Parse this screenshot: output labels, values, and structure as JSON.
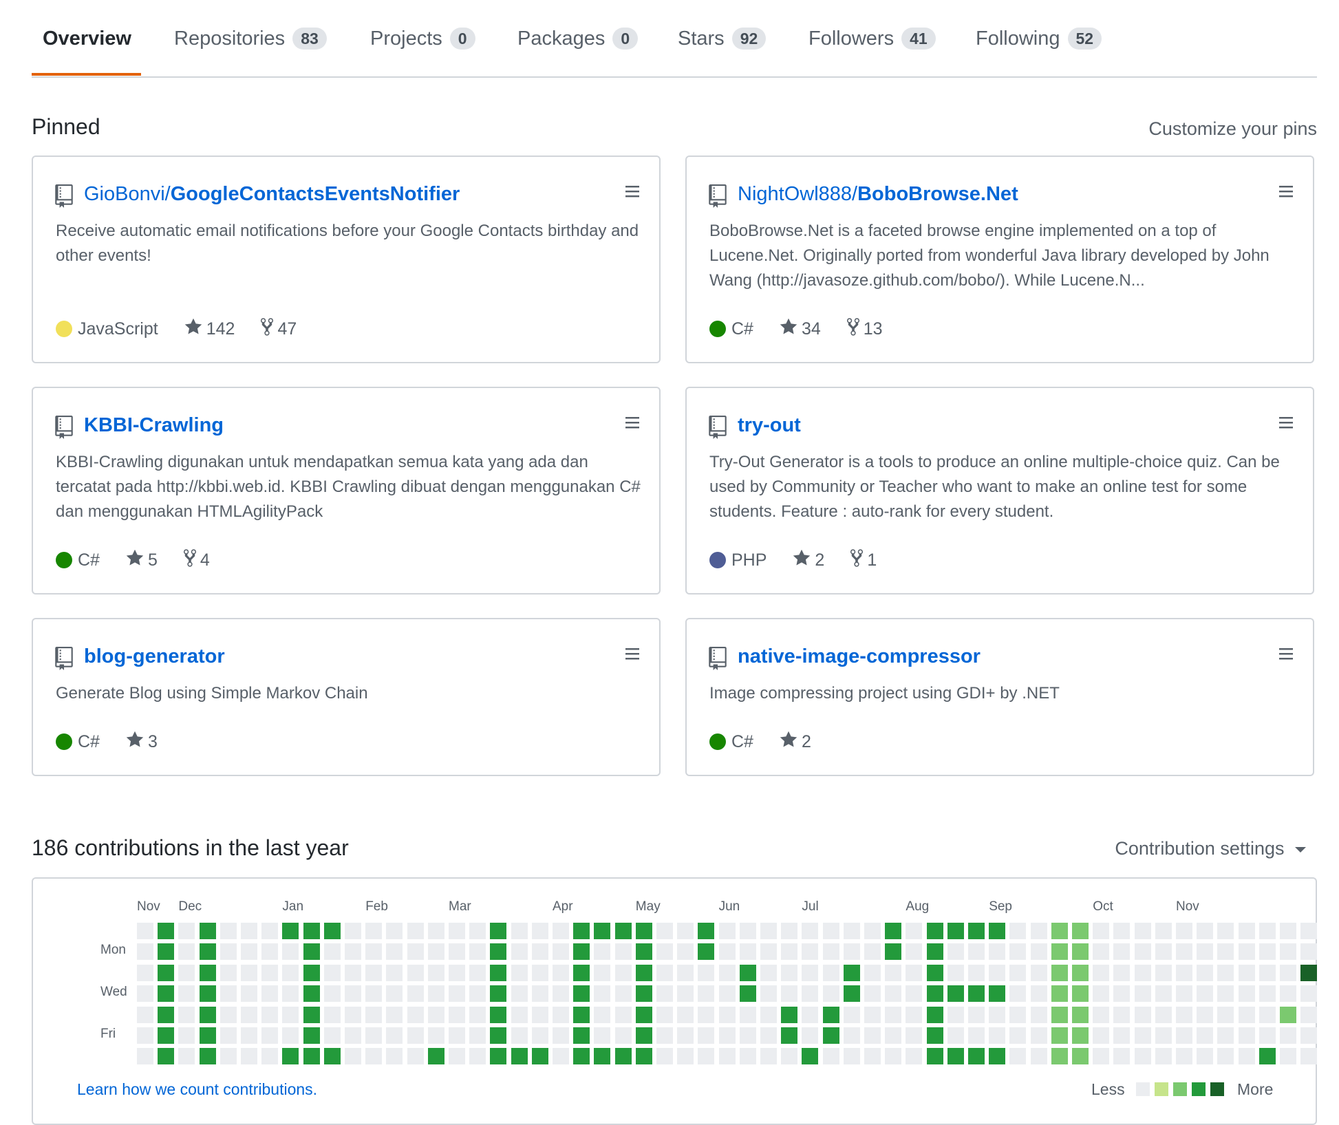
{
  "tabs": [
    {
      "label": "Overview",
      "count": null
    },
    {
      "label": "Repositories",
      "count": "83"
    },
    {
      "label": "Projects",
      "count": "0"
    },
    {
      "label": "Packages",
      "count": "0"
    },
    {
      "label": "Stars",
      "count": "92"
    },
    {
      "label": "Followers",
      "count": "41"
    },
    {
      "label": "Following",
      "count": "52"
    }
  ],
  "pinned": {
    "title": "Pinned",
    "customize": "Customize your pins"
  },
  "cards": [
    {
      "owner": "GioBonvi/",
      "name": "GoogleContactsEventsNotifier",
      "desc": "Receive automatic email notifications before your Google Contacts birthday and other events!",
      "lang": "JavaScript",
      "lang_color": "#f1e05a",
      "stars": "142",
      "forks": "47"
    },
    {
      "owner": "NightOwl888/",
      "name": "BoboBrowse.Net",
      "desc": "BoboBrowse.Net is a faceted browse engine implemented on a top of Lucene.Net. Originally ported from wonderful Java library developed by John Wang (http://javasoze.github.com/bobo/). While Lucene.N...",
      "lang": "C#",
      "lang_color": "#178600",
      "stars": "34",
      "forks": "13"
    },
    {
      "owner": "",
      "name": "KBBI-Crawling",
      "desc": "KBBI-Crawling digunakan untuk mendapatkan semua kata yang ada dan tercatat pada http://kbbi.web.id. KBBI Crawling dibuat dengan menggunakan C# dan menggunakan HTMLAgilityPack",
      "lang": "C#",
      "lang_color": "#178600",
      "stars": "5",
      "forks": "4"
    },
    {
      "owner": "",
      "name": "try-out",
      "desc": "Try-Out Generator is a tools to produce an online multiple-choice quiz. Can be used by Community or Teacher who want to make an online test for some students. Feature : auto-rank for every student.",
      "lang": "PHP",
      "lang_color": "#4F5D95",
      "stars": "2",
      "forks": "1"
    },
    {
      "owner": "",
      "name": "blog-generator",
      "desc": "Generate Blog using Simple Markov Chain",
      "lang": "C#",
      "lang_color": "#178600",
      "stars": "3",
      "forks": null
    },
    {
      "owner": "",
      "name": "native-image-compressor",
      "desc": "Image compressing project using GDI+ by .NET",
      "lang": "C#",
      "lang_color": "#178600",
      "stars": "2",
      "forks": null
    }
  ],
  "contrib": {
    "title": "186 contributions in the last year",
    "settings": "Contribution settings",
    "months": [
      "Nov",
      "Dec",
      "Jan",
      "Feb",
      "Mar",
      "Apr",
      "May",
      "Jun",
      "Jul",
      "Aug",
      "Sep",
      "Oct",
      "Nov"
    ],
    "days": [
      "Mon",
      "Wed",
      "Fri"
    ],
    "learn": "Learn how we count contributions.",
    "less": "Less",
    "more": "More",
    "colors": [
      "#ebedf0",
      "#c6e48b",
      "#7bc96f",
      "#239a3b",
      "#196127"
    ],
    "grid": [
      "0000000",
      "3333333",
      "0000000",
      "3333333",
      "0000000",
      "0000000",
      "0000000",
      "3000003",
      "3333333",
      "3000003",
      "0000000",
      "0000000",
      "0000000",
      "0000000",
      "0000003",
      "0000000",
      "0000000",
      "3333333",
      "0000003",
      "0000003",
      "0000000",
      "3333333",
      "3000003",
      "3000003",
      "3333333",
      "0000000",
      "0000000",
      "3300000",
      "0000000",
      "0033000",
      "0000000",
      "0000330",
      "0000003",
      "0000330",
      "0033000",
      "0000000",
      "3300000",
      "0000000",
      "3333333",
      "3003003",
      "3003003",
      "3003003",
      "0000000",
      "0000000",
      "2222222",
      "2222222",
      "0000000",
      "0000000",
      "0000000",
      "0000000",
      "0000000",
      "0000000",
      "0000000",
      "0000000",
      "0000003",
      "0000200",
      "0040000"
    ]
  }
}
